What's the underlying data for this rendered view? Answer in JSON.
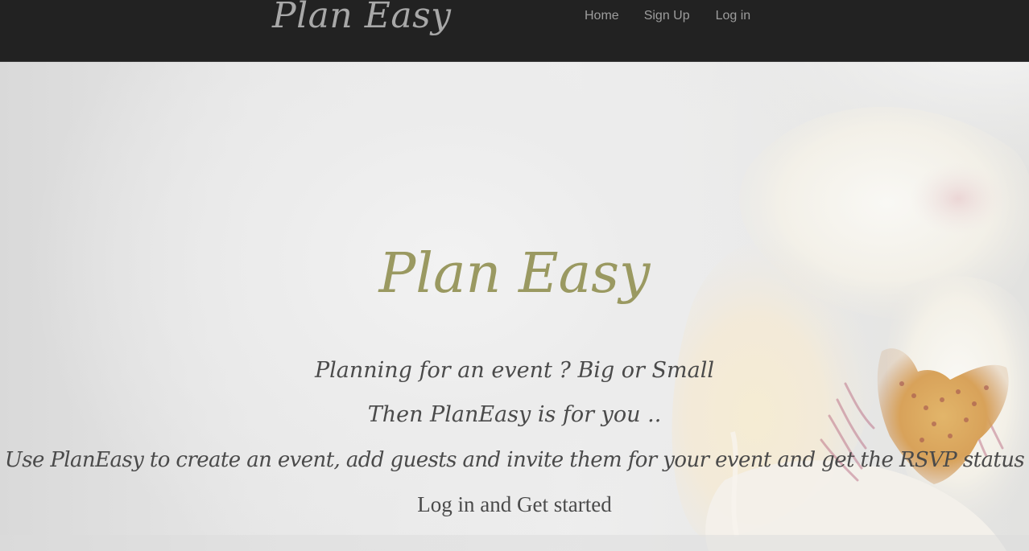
{
  "navbar": {
    "brand": "Plan Easy",
    "links": [
      "Home",
      "Sign Up",
      "Log in"
    ]
  },
  "hero": {
    "title": "Plan Easy",
    "line1": "Planning for an event ? Big or Small",
    "line2": "Then PlanEasy is for you ..",
    "line3": "Use PlanEasy to create an event, add guests and invite them for your event and get the RSVP status",
    "cta": "Log in and Get started"
  },
  "colors": {
    "navbar_bg": "#222222",
    "nav_text": "#9d9d9d",
    "title": "#9a9961",
    "body_text": "#4a4a4a"
  }
}
